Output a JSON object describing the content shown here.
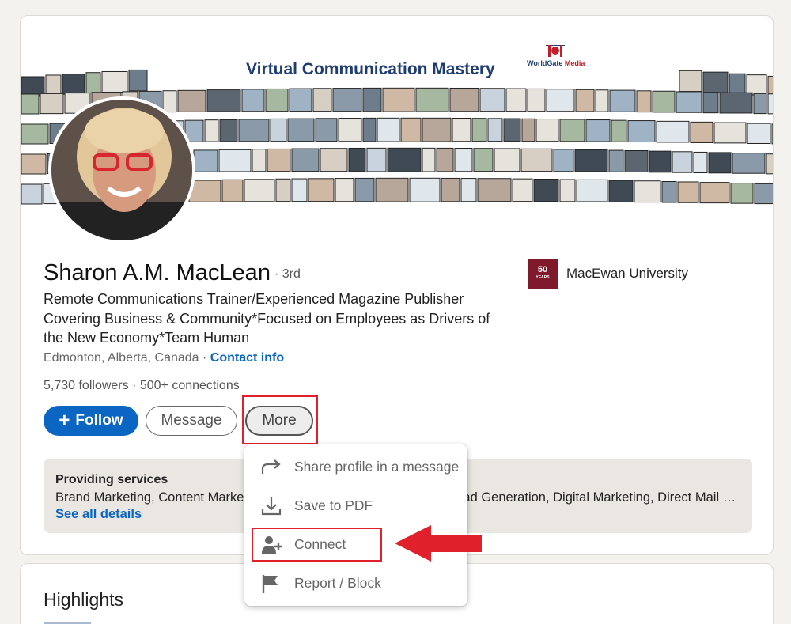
{
  "banner": {
    "title": "Virtual Communication Mastery",
    "brand_a": "WorldGate",
    "brand_b": " Media"
  },
  "profile": {
    "name": "Sharon A.M. MacLean",
    "degree": "· 3rd",
    "headline": "Remote Communications Trainer/Experienced Magazine Publisher Covering Business & Community*Focused on Employees as Drivers of the New Economy*Team Human",
    "location": "Edmonton, Alberta, Canada",
    "location_sep": " · ",
    "contact_label": "Contact info",
    "followers": "5,730 followers",
    "connections": " · 500+ connections"
  },
  "education": {
    "logo_top": "50",
    "logo_bottom": "YEARS",
    "name": "MacEwan University"
  },
  "actions": {
    "follow_label": "Follow",
    "message_label": "Message",
    "more_label": "More"
  },
  "services": {
    "title": "Providing services",
    "list": "Brand Marketing, Content Marketing, Copywriting, Email Marketing, Lead Generation, Digital Marketing, Direct Mail Marke...",
    "link": "See all details"
  },
  "highlights": {
    "title": "Highlights"
  },
  "menu": {
    "items": [
      {
        "label": "Share profile in a message",
        "icon": "share-arrow-icon"
      },
      {
        "label": "Save to PDF",
        "icon": "download-icon"
      },
      {
        "label": "Connect",
        "icon": "add-person-icon"
      },
      {
        "label": "Report / Block",
        "icon": "flag-icon"
      }
    ]
  },
  "colors": {
    "primary": "#0a66c2",
    "annotation": "#e0202a",
    "edu_logo": "#7e1a2b",
    "banner_title": "#1f3c73"
  }
}
